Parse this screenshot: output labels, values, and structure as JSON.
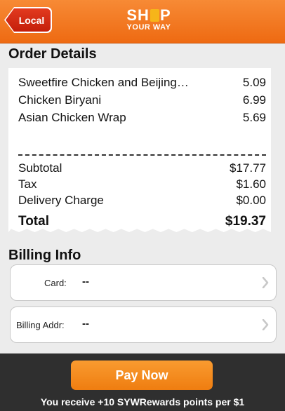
{
  "header": {
    "back_label": "Local",
    "logo_top_left": "SH",
    "logo_top_right": "P",
    "logo_bottom": "YOUR WAY"
  },
  "order": {
    "title": "Order Details",
    "items": [
      {
        "name": "Sweetfire Chicken and Beijing…",
        "price": "5.09"
      },
      {
        "name": "Chicken Biryani",
        "price": "6.99"
      },
      {
        "name": "Asian Chicken Wrap",
        "price": "5.69"
      }
    ],
    "subtotal_label": "Subtotal",
    "subtotal": "$17.77",
    "tax_label": "Tax",
    "tax": "$1.60",
    "delivery_label": "Delivery Charge",
    "delivery": "$0.00",
    "total_label": "Total",
    "total": "$19.37"
  },
  "billing": {
    "title": "Billing Info",
    "card_label": "Card:",
    "card_value": "--",
    "addr_label": "Billing Addr:",
    "addr_value": "--"
  },
  "footer": {
    "pay_label": "Pay Now",
    "reward_text": "You receive +10 SYWRewards points per $1"
  },
  "colors": {
    "accent": "#ef7d10",
    "back_button": "#c41f0a",
    "footer_bg": "#2f2f2f"
  }
}
